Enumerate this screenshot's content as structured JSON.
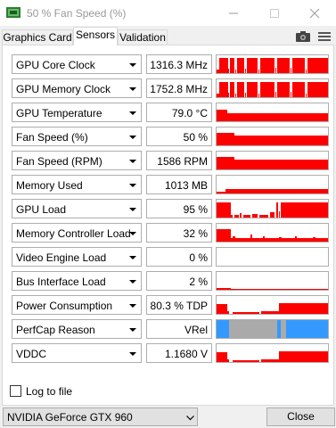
{
  "window": {
    "title": "50 % Fan Speed (%)"
  },
  "tabs": [
    {
      "label": "Graphics Card"
    },
    {
      "label": "Sensors"
    },
    {
      "label": "Validation"
    }
  ],
  "active_tab": "Sensors",
  "sensors": [
    {
      "name": "GPU Core Clock",
      "value": "1316.3 MHz"
    },
    {
      "name": "GPU Memory Clock",
      "value": "1752.8 MHz"
    },
    {
      "name": "GPU Temperature",
      "value": "79.0 °C"
    },
    {
      "name": "Fan Speed (%)",
      "value": "50 %"
    },
    {
      "name": "Fan Speed (RPM)",
      "value": "1586 RPM"
    },
    {
      "name": "Memory Used",
      "value": "1013 MB"
    },
    {
      "name": "GPU Load",
      "value": "95 %"
    },
    {
      "name": "Memory Controller Load",
      "value": "32 %"
    },
    {
      "name": "Video Engine Load",
      "value": "0 %"
    },
    {
      "name": "Bus Interface Load",
      "value": "2 %"
    },
    {
      "name": "Power Consumption",
      "value": "80.3 % TDP"
    },
    {
      "name": "PerfCap Reason",
      "value": "VRel"
    },
    {
      "name": "VDDC",
      "value": "1.1680 V"
    }
  ],
  "log_to_file": {
    "label": "Log to file",
    "checked": false
  },
  "gpu_select": {
    "selected": "NVIDIA GeForce GTX 960"
  },
  "buttons": {
    "close_label": "Close"
  },
  "colors": {
    "graph_red": "#ff0000",
    "perfcap_blue": "#3399ff",
    "perfcap_gray": "#aaaaaa"
  },
  "icons": {
    "app": "gpu-z-icon",
    "camera": "camera-icon",
    "menu": "hamburger-menu-icon"
  }
}
